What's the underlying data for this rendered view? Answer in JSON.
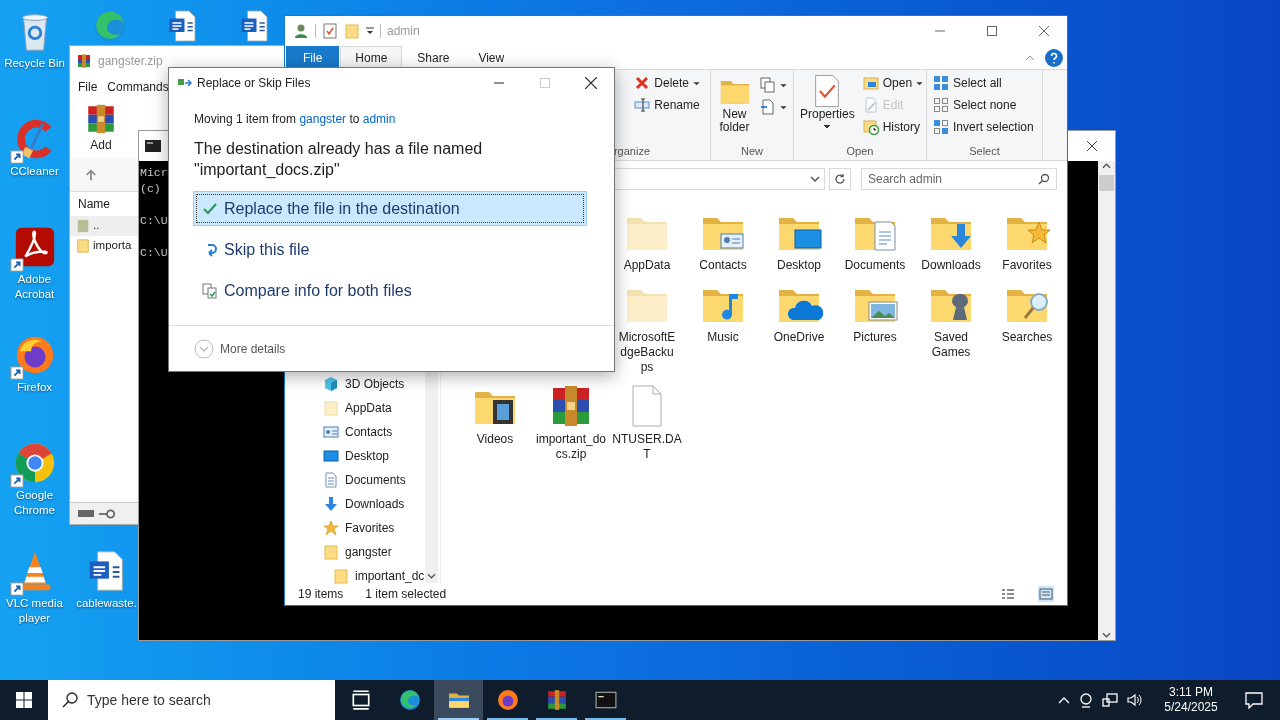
{
  "desktop_icons": [
    {
      "kind": "recycle-bin",
      "label": "Recycle Bin",
      "shortcut": false
    },
    {
      "kind": "edge",
      "shortcut": false
    },
    {
      "kind": "word",
      "shortcut": false
    },
    {
      "kind": "word",
      "shortcut": false
    },
    {
      "kind": "ccleaner",
      "label": "CCleaner",
      "shortcut": true
    },
    {
      "kind": "acrobat",
      "label": "Adobe Acrobat",
      "shortcut": true
    },
    {
      "kind": "firefox",
      "label": "Firefox",
      "shortcut": true
    },
    {
      "kind": "chrome",
      "label": "Google Chrome",
      "shortcut": true
    },
    {
      "kind": "vlc",
      "label": "VLC media player",
      "shortcut": true
    },
    {
      "kind": "word",
      "label": "cablewaste.",
      "shortcut": false
    }
  ],
  "winrar": {
    "title": "gangster.zip",
    "menu": [
      "File",
      "Commands"
    ],
    "toolbar": [
      "Add"
    ],
    "column": "Name",
    "rows": [
      {
        "kind": "up",
        "name": ".."
      },
      {
        "kind": "folder",
        "name": "importa"
      }
    ]
  },
  "console": {
    "lines": [
      {
        "text": "Micr",
        "gap_before": false
      },
      {
        "text": "(c)",
        "gap_before": false
      },
      {
        "text": "C:\\U",
        "gap_before": true
      },
      {
        "text": "C:\\U",
        "gap_before": true
      }
    ]
  },
  "explorer": {
    "title": "admin",
    "tabs": [
      {
        "label": "File",
        "kind": "file",
        "selected": false
      },
      {
        "label": "Home",
        "kind": "tab",
        "selected": true
      },
      {
        "label": "Share",
        "kind": "tab",
        "selected": false
      },
      {
        "label": "View",
        "kind": "tab",
        "selected": false
      }
    ],
    "ribbon": [
      {
        "label": "rganize",
        "small": [
          {
            "kind": "delete",
            "label": "Delete",
            "dropdown": true,
            "disabled": false
          },
          {
            "kind": "rename",
            "label": "Rename",
            "dropdown": false,
            "disabled": false
          }
        ]
      },
      {
        "label": "New",
        "large": [
          {
            "kind": "new-folder",
            "label": "New folder",
            "dropdown": false
          }
        ],
        "small": [
          {
            "kind": "copy-path",
            "dropdown": true,
            "disabled": false
          },
          {
            "kind": "easy-access",
            "dropdown": true,
            "disabled": false
          }
        ]
      },
      {
        "label": "Open",
        "large": [
          {
            "kind": "properties",
            "label": "Properties",
            "dropdown": true
          }
        ],
        "small": [
          {
            "kind": "open",
            "label": "Open",
            "dropdown": true,
            "disabled": false
          },
          {
            "kind": "edit",
            "label": "Edit",
            "dropdown": false,
            "disabled": true
          },
          {
            "kind": "history",
            "label": "History",
            "dropdown": false,
            "disabled": false
          }
        ]
      },
      {
        "label": "Select",
        "small": [
          {
            "kind": "select-all",
            "label": "Select all",
            "dropdown": false,
            "disabled": false
          },
          {
            "kind": "select-none",
            "label": "Select none",
            "dropdown": false,
            "disabled": false
          },
          {
            "kind": "invert",
            "label": "Invert selection",
            "dropdown": false,
            "disabled": false
          }
        ]
      }
    ],
    "search": {
      "placeholder": "Search admin"
    },
    "nav": [
      {
        "kind": "cube",
        "label": "3D Objects"
      },
      {
        "kind": "hidden-folder",
        "label": "AppData"
      },
      {
        "kind": "contacts",
        "label": "Contacts"
      },
      {
        "kind": "desktop",
        "label": "Desktop"
      },
      {
        "kind": "documents",
        "label": "Documents"
      },
      {
        "kind": "downloads",
        "label": "Downloads"
      },
      {
        "kind": "favorites",
        "label": "Favorites"
      },
      {
        "kind": "folder",
        "label": "gangster",
        "children": [
          {
            "kind": "folder",
            "label": "important_dc"
          }
        ]
      }
    ],
    "item_rows": [
      [
        {
          "kind": "hidden-folder",
          "label": "AppData"
        },
        {
          "kind": "contacts",
          "label": "Contacts"
        },
        {
          "kind": "desktop",
          "label": "Desktop"
        },
        {
          "kind": "documents",
          "label": "Documents"
        },
        {
          "kind": "downloads",
          "label": "Downloads"
        },
        {
          "kind": "favorites",
          "label": "Favorites"
        }
      ],
      [
        {
          "kind": "hidden-folder",
          "label": "MicrosoftEdgeBackups"
        },
        {
          "kind": "music",
          "label": "Music"
        },
        {
          "kind": "onedrive",
          "label": "OneDrive"
        },
        {
          "kind": "pictures",
          "label": "Pictures"
        },
        {
          "kind": "games",
          "label": "Saved Games"
        },
        {
          "kind": "searches",
          "label": "Searches"
        }
      ],
      [
        {
          "kind": "videos",
          "label": "Videos"
        },
        {
          "kind": "zip",
          "label": "important_docs.zip"
        },
        {
          "kind": "file",
          "label": "NTUSER.DAT"
        }
      ]
    ],
    "status": [
      "19 items",
      "1 item selected"
    ]
  },
  "dialog": {
    "title": "Replace or Skip Files",
    "summary": [
      {
        "text": "Moving 1 item from ",
        "kind": "text"
      },
      {
        "text": "gangster",
        "kind": "link"
      },
      {
        "text": " to ",
        "kind": "text"
      },
      {
        "text": "admin",
        "kind": "link"
      }
    ],
    "message": "The destination already has a file named \"important_docs.zip\"",
    "options": [
      {
        "kind": "replace",
        "label": "Replace the file in the destination",
        "selected": true
      },
      {
        "kind": "skip",
        "label": "Skip this file",
        "selected": false
      },
      {
        "kind": "compare",
        "label": "Compare info for both files",
        "selected": false
      }
    ],
    "more": "More details"
  },
  "taskbar": {
    "search": {
      "placeholder": "Type here to search"
    },
    "apps": [
      {
        "kind": "task-view",
        "running": false,
        "selected": false
      },
      {
        "kind": "edge",
        "running": false,
        "selected": false
      },
      {
        "kind": "explorer",
        "running": true,
        "selected": true
      },
      {
        "kind": "firefox",
        "running": true,
        "selected": false
      },
      {
        "kind": "winrar",
        "running": true,
        "selected": false
      },
      {
        "kind": "cmd",
        "running": true,
        "selected": false
      }
    ],
    "time": "3:11 PM",
    "date": "5/24/2025"
  }
}
